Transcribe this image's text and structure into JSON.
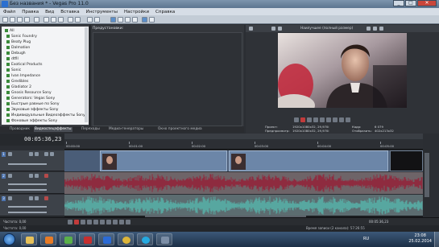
{
  "window": {
    "title": "Без названия * - Vegas Pro 11.0",
    "controls": [
      "_",
      "□",
      "✕"
    ]
  },
  "menu": [
    "Файл",
    "Правка",
    "Вид",
    "Вставка",
    "Инструменты",
    "Настройки",
    "Справка"
  ],
  "explorer": {
    "items": [
      "All",
      "Sonic Foundry",
      "Beaty Plug",
      "Dalmation",
      "Debugh",
      "dtfil",
      "Exotical Products",
      "Sonic",
      "Ivan Impedance",
      "Gredibles",
      "Gladiator 2",
      "Gnosis Resource Sony",
      "Generators: Vegas Sony",
      "Быстрые равные по Sony",
      "Звуковые эффекты Sony",
      "Индивидуальные Видеоэффекты Sony",
      "Фоновые эффекты Sony",
      "Vegas Sony"
    ]
  },
  "fxpanel": {
    "header": "Предустановки:"
  },
  "panel_tabs": [
    "Проводник",
    "Видеоспецэффекты",
    "Переходы",
    "Медиа-генераторы",
    "Окно проектного медиа"
  ],
  "preview": {
    "quality": "Наилучшее (полный размер)",
    "project_label": "Проект:",
    "project_value": "1920x1080x32, 29,970i",
    "preview_label": "Предпросмотр:",
    "preview_value": "1920x1080x32, 29,970i",
    "frame_label": "Кадр:",
    "frame_value": "6 079",
    "display_label": "Отобразить:",
    "display_value": "402x213x32"
  },
  "timeline": {
    "timecode": "00:05:36,23",
    "ruler_ticks": [
      "00:00:00",
      "00:01:00",
      "00:02:00",
      "00:03:00",
      "00:04:00",
      "00:05:00",
      "00:06:00"
    ],
    "rate_label": "Частота: 0,00",
    "end_timecode": "00:05:36,23"
  },
  "tracks": {
    "video_num": "1",
    "audio1_num": "2",
    "audio2_num": "3",
    "vol_label": "Громкость",
    "pan_label": "Центр"
  },
  "status": {
    "record_time": "Время записи (2 канала): 57:26:55",
    "left": "Частота: 0,00"
  },
  "taskbar": {
    "lang": "RU",
    "time": "23:08",
    "date": "25.02.2014"
  },
  "colors": {
    "audio_wave_1": "#8e2b3f",
    "audio_wave_2": "#57a7a0",
    "video_track": "#6c86a8",
    "accent": "#4d73ad"
  }
}
